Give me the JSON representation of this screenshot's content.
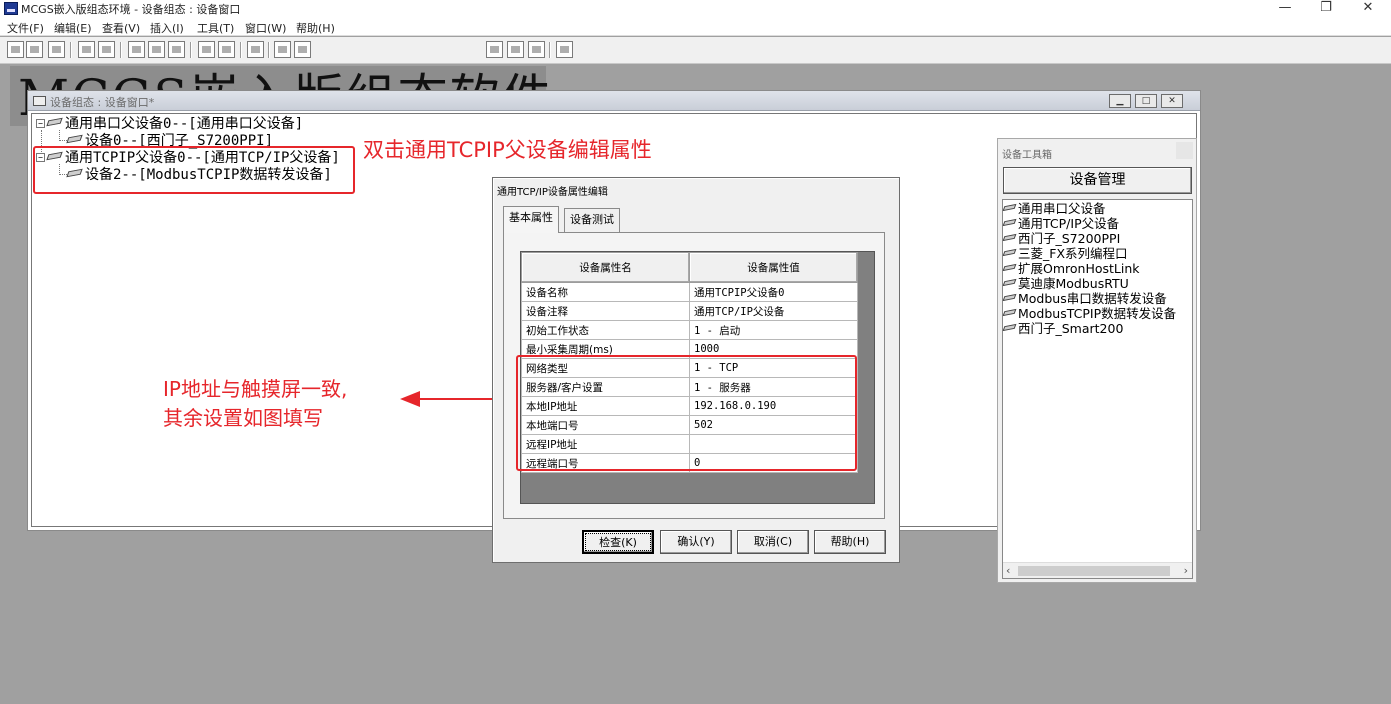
{
  "app": {
    "title": "MCGS嵌入版组态环境 - 设备组态 : 设备窗口",
    "minimize": "—",
    "restore": "❐",
    "close": "✕"
  },
  "menu": [
    "文件(F)",
    "编辑(E)",
    "查看(V)",
    "插入(I)",
    "工具(T)",
    "窗口(W)",
    "帮助(H)"
  ],
  "workspace": {
    "watermark": "MCGS嵌入版组态软件"
  },
  "device_window": {
    "title": "设备组态 : 设备窗口*",
    "tree": [
      {
        "label": "通用串口父设备0--[通用串口父设备]",
        "expand": "−"
      },
      {
        "label": "设备0--[西门子_S7200PPI]"
      },
      {
        "label": "通用TCPIP父设备0--[通用TCP/IP父设备]",
        "expand": "−"
      },
      {
        "label": "设备2--[ModbusTCPIP数据转发设备]"
      }
    ]
  },
  "annotations": {
    "double_click_hint": "双击通用TCPIP父设备编辑属性",
    "ip_hint_line1": "IP地址与触摸屏一致,",
    "ip_hint_line2": "其余设置如图填写"
  },
  "dialog": {
    "title": "通用TCP/IP设备属性编辑",
    "tabs": [
      "基本属性",
      "设备测试"
    ],
    "headers": [
      "设备属性名",
      "设备属性值"
    ],
    "rows": [
      {
        "name": "设备名称",
        "value": "通用TCPIP父设备0"
      },
      {
        "name": "设备注释",
        "value": "通用TCP/IP父设备"
      },
      {
        "name": "初始工作状态",
        "value": "1 - 启动"
      },
      {
        "name": "最小采集周期(ms)",
        "value": "1000"
      },
      {
        "name": "网络类型",
        "value": "1 - TCP"
      },
      {
        "name": "服务器/客户设置",
        "value": "1 - 服务器"
      },
      {
        "name": "本地IP地址",
        "value": "192.168.0.190"
      },
      {
        "name": "本地端口号",
        "value": "502"
      },
      {
        "name": "远程IP地址",
        "value": ""
      },
      {
        "name": "远程端口号",
        "value": "0"
      }
    ],
    "buttons": {
      "check": "检查(K)",
      "confirm": "确认(Y)",
      "cancel": "取消(C)",
      "help": "帮助(H)"
    }
  },
  "toolbox": {
    "title": "设备工具箱",
    "manage_button": "设备管理",
    "items": [
      "通用串口父设备",
      "通用TCP/IP父设备",
      "西门子_S7200PPI",
      "三菱_FX系列编程口",
      "扩展OmronHostLink",
      "莫迪康ModbusRTU",
      "Modbus串口数据转发设备",
      "ModbusTCPIP数据转发设备",
      "西门子_Smart200"
    ],
    "scroll_left": "‹",
    "scroll_right": "›"
  },
  "colors": {
    "annotation": "#e6262b",
    "workspace_bg": "#a0a0a0"
  }
}
